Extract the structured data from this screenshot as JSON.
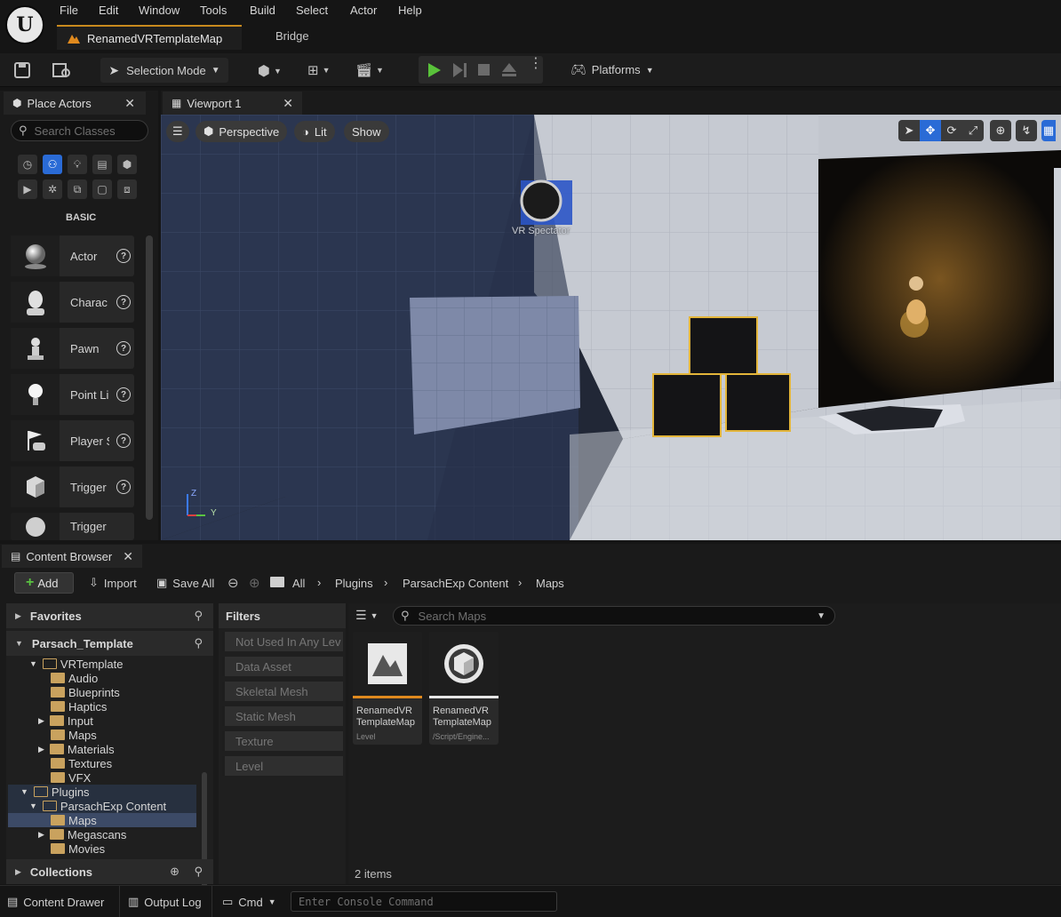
{
  "menubar": {
    "items": [
      "File",
      "Edit",
      "Window",
      "Tools",
      "Build",
      "Select",
      "Actor",
      "Help"
    ],
    "tabs": {
      "map": "RenamedVRTemplateMap",
      "bridge": "Bridge"
    }
  },
  "toolbar": {
    "selection_mode": "Selection Mode",
    "platforms": "Platforms"
  },
  "place_actors": {
    "title": "Place Actors",
    "search_placeholder": "Search Classes",
    "category": "BASIC",
    "items": [
      "Actor",
      "Charac",
      "Pawn",
      "Point Li",
      "Player S",
      "Trigger",
      "Trigger"
    ]
  },
  "viewport": {
    "title": "Viewport 1",
    "perspective": "Perspective",
    "lit": "Lit",
    "show": "Show",
    "spectator_label": "VR Spectator",
    "axis_z": "Z",
    "axis_y": "Y"
  },
  "content_browser": {
    "title": "Content Browser",
    "add": "Add",
    "import": "Import",
    "save_all": "Save All",
    "breadcrumb": [
      "All",
      "Plugins",
      "ParsachExp Content",
      "Maps"
    ],
    "favorites": "Favorites",
    "project": "Parsach_Template",
    "tree": [
      {
        "label": "VRTemplate",
        "indent": 0,
        "open": true,
        "arrow": "down"
      },
      {
        "label": "Audio",
        "indent": 1
      },
      {
        "label": "Blueprints",
        "indent": 1
      },
      {
        "label": "Haptics",
        "indent": 1
      },
      {
        "label": "Input",
        "indent": 1,
        "arrow": "right"
      },
      {
        "label": "Maps",
        "indent": 1
      },
      {
        "label": "Materials",
        "indent": 1,
        "arrow": "right"
      },
      {
        "label": "Textures",
        "indent": 1
      },
      {
        "label": "VFX",
        "indent": 1
      },
      {
        "label": "Plugins",
        "indent": -1,
        "open": true,
        "arrow": "down"
      },
      {
        "label": "ParsachExp Content",
        "indent": 0,
        "open": true,
        "arrow": "down"
      },
      {
        "label": "Maps",
        "indent": 1,
        "selected": true
      },
      {
        "label": "Megascans",
        "indent": 1,
        "arrow": "right"
      },
      {
        "label": "Movies",
        "indent": 1
      }
    ],
    "collections": "Collections",
    "filters_title": "Filters",
    "filters": [
      "Not Used In Any Lev",
      "Data Asset",
      "Skeletal Mesh",
      "Static Mesh",
      "Texture",
      "Level"
    ],
    "search_placeholder": "Search Maps",
    "assets": [
      {
        "name1": "RenamedVR",
        "name2": "TemplateMap",
        "type": "Level",
        "accent": "#e08a1e"
      },
      {
        "name1": "RenamedVR",
        "name2": "TemplateMap",
        "type": "/Script/Engine...",
        "accent": "#e6e6e6"
      }
    ],
    "item_count": "2 items"
  },
  "statusbar": {
    "content_drawer": "Content Drawer",
    "output_log": "Output Log",
    "cmd": "Cmd",
    "console_placeholder": "Enter Console Command"
  }
}
